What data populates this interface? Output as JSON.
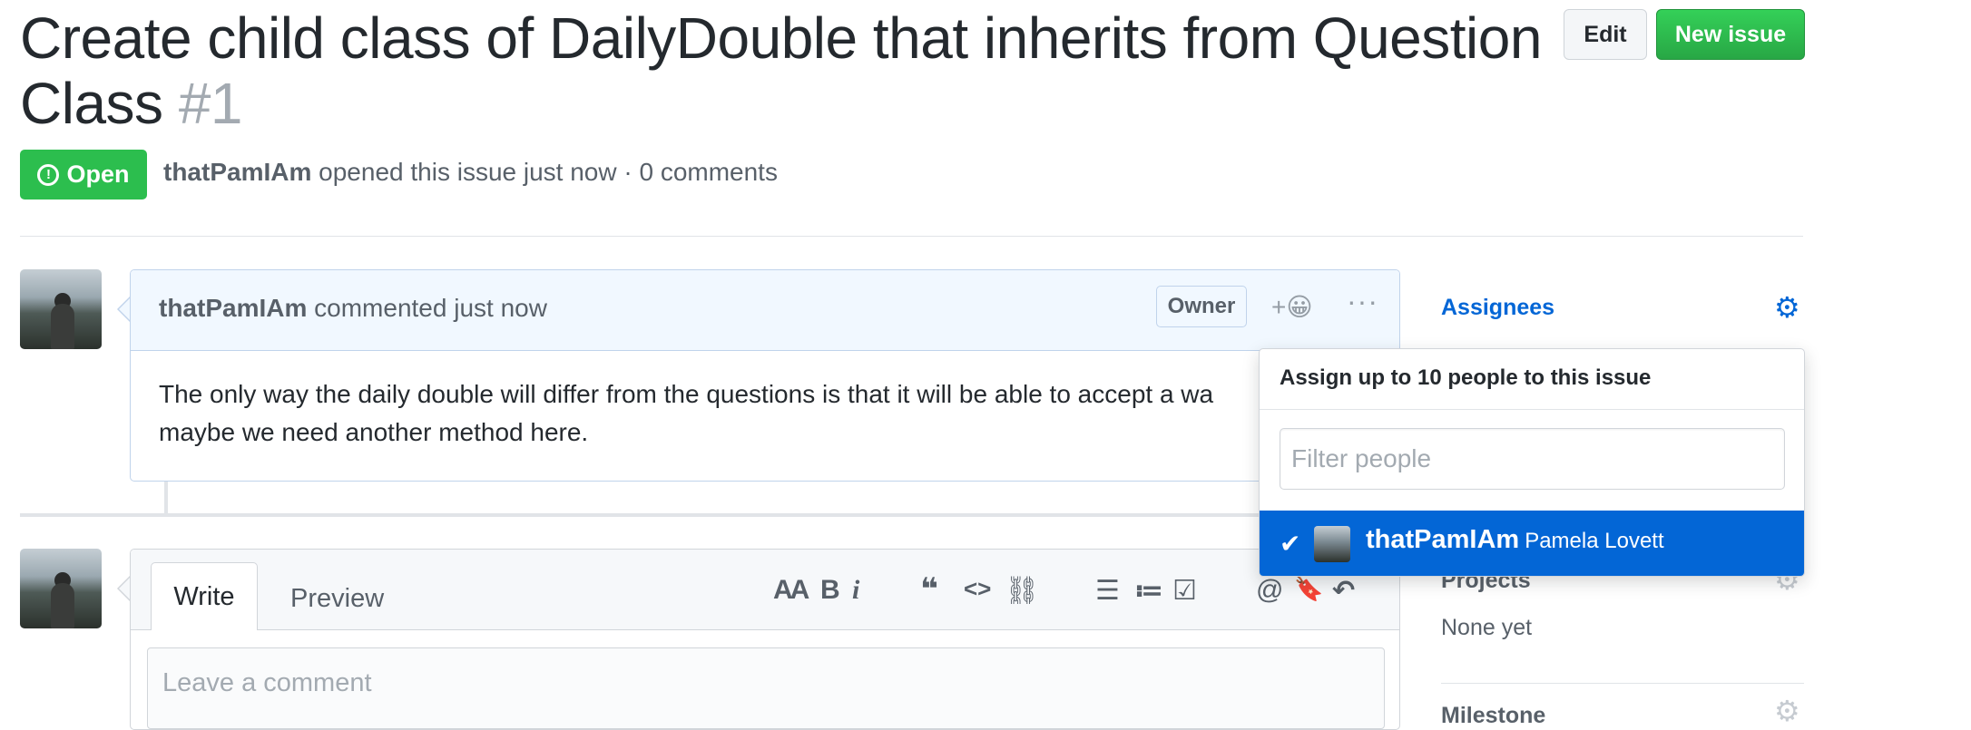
{
  "issue": {
    "title": "Create child class of DailyDouble that inherits from Question Class",
    "number": "#1",
    "state": "Open",
    "author": "thatPamIAm",
    "meta_text": "opened this issue just now · 0 comments"
  },
  "header": {
    "edit_label": "Edit",
    "new_issue_label": "New issue"
  },
  "comment": {
    "author": "thatPamIAm",
    "action": "commented just now",
    "role_badge": "Owner",
    "reaction_label": "+😀",
    "more_label": "···",
    "body_line1": "The only way the daily double will differ from the questions is that it will be able to accept a wa",
    "body_line2": "maybe we need another method here."
  },
  "editor": {
    "tab_write": "Write",
    "tab_preview": "Preview",
    "placeholder": "Leave a comment",
    "tools": {
      "heading": "AA",
      "bold": "B",
      "italic": "i",
      "quote": "❝",
      "code": "<>",
      "link": "⛓",
      "ul": "☰",
      "ol": "≔",
      "tasks": "☑",
      "mention": "@",
      "saved": "🔖",
      "reply": "↶"
    }
  },
  "sidebar": {
    "assignees_label": "Assignees",
    "projects_label": "Projects",
    "projects_value": "None yet",
    "milestone_label": "Milestone"
  },
  "assign_dropdown": {
    "title": "Assign up to 10 people to this issue",
    "filter_placeholder": "Filter people",
    "items": [
      {
        "login": "thatPamIAm",
        "name": "Pamela Lovett",
        "selected": true
      }
    ]
  },
  "colors": {
    "open_green": "#2cbe4e",
    "new_issue_green": "#28a745",
    "link_blue": "#0366d6",
    "comment_header_bg": "#f1f8ff"
  }
}
